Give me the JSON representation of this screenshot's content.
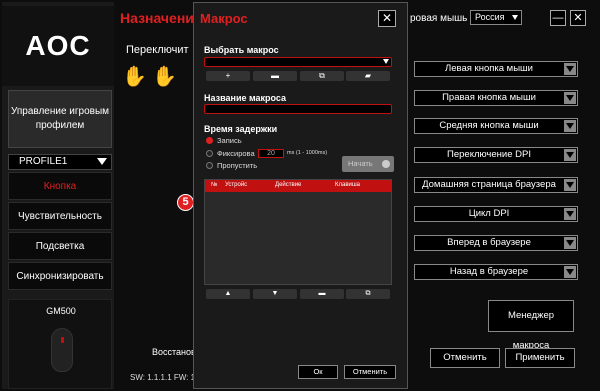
{
  "app": {
    "logo": "AOC",
    "profile_label": "Управление игровым профилем",
    "profile_select": "PROFILE1",
    "nav": [
      "Кнопка",
      "Чувствительность",
      "Подсветка",
      "Синхронизировать"
    ],
    "device_name": "GM500",
    "title": "Назначени",
    "sub_label": "Переключит",
    "topbar_label": "ровая мышь",
    "language": "Россия",
    "minimize": "—",
    "close": "✕",
    "badge": "5",
    "restore_text": "Восстанов",
    "version": "SW: 1.1.1.1   FW: 1.0",
    "assignments": [
      "Левая кнопка мыши",
      "Правая кнопка мыши",
      "Средняя кнопка мыши",
      "Переключение DPI",
      "Домашняя страница браузера",
      "Цикл DPI",
      "Вперед в браузере",
      "Назад в браузере"
    ],
    "macro_manager": "Менеджер макроса",
    "cancel": "Отменить",
    "apply": "Применить"
  },
  "modal": {
    "title": "Макрос",
    "close": "✕",
    "select_macro_label": "Выбрать макрос",
    "tools": [
      "+",
      "▬",
      "⧉",
      "▰"
    ],
    "macro_name_label": "Название макроса",
    "delay_label": "Время задержки",
    "radio_record": "Запись",
    "radio_fixed": "Фиксирова",
    "delay_value": "20",
    "delay_unit": "ms (1 - 1000ms)",
    "radio_skip": "Пропустить",
    "run_label": "Начать",
    "table_headers": [
      "№",
      "Устройс",
      "Действие",
      "Клавиша"
    ],
    "nav_tools": [
      "▲",
      "▼",
      "▬",
      "⧉"
    ],
    "ok": "Ок",
    "cancel": "Отменить"
  }
}
